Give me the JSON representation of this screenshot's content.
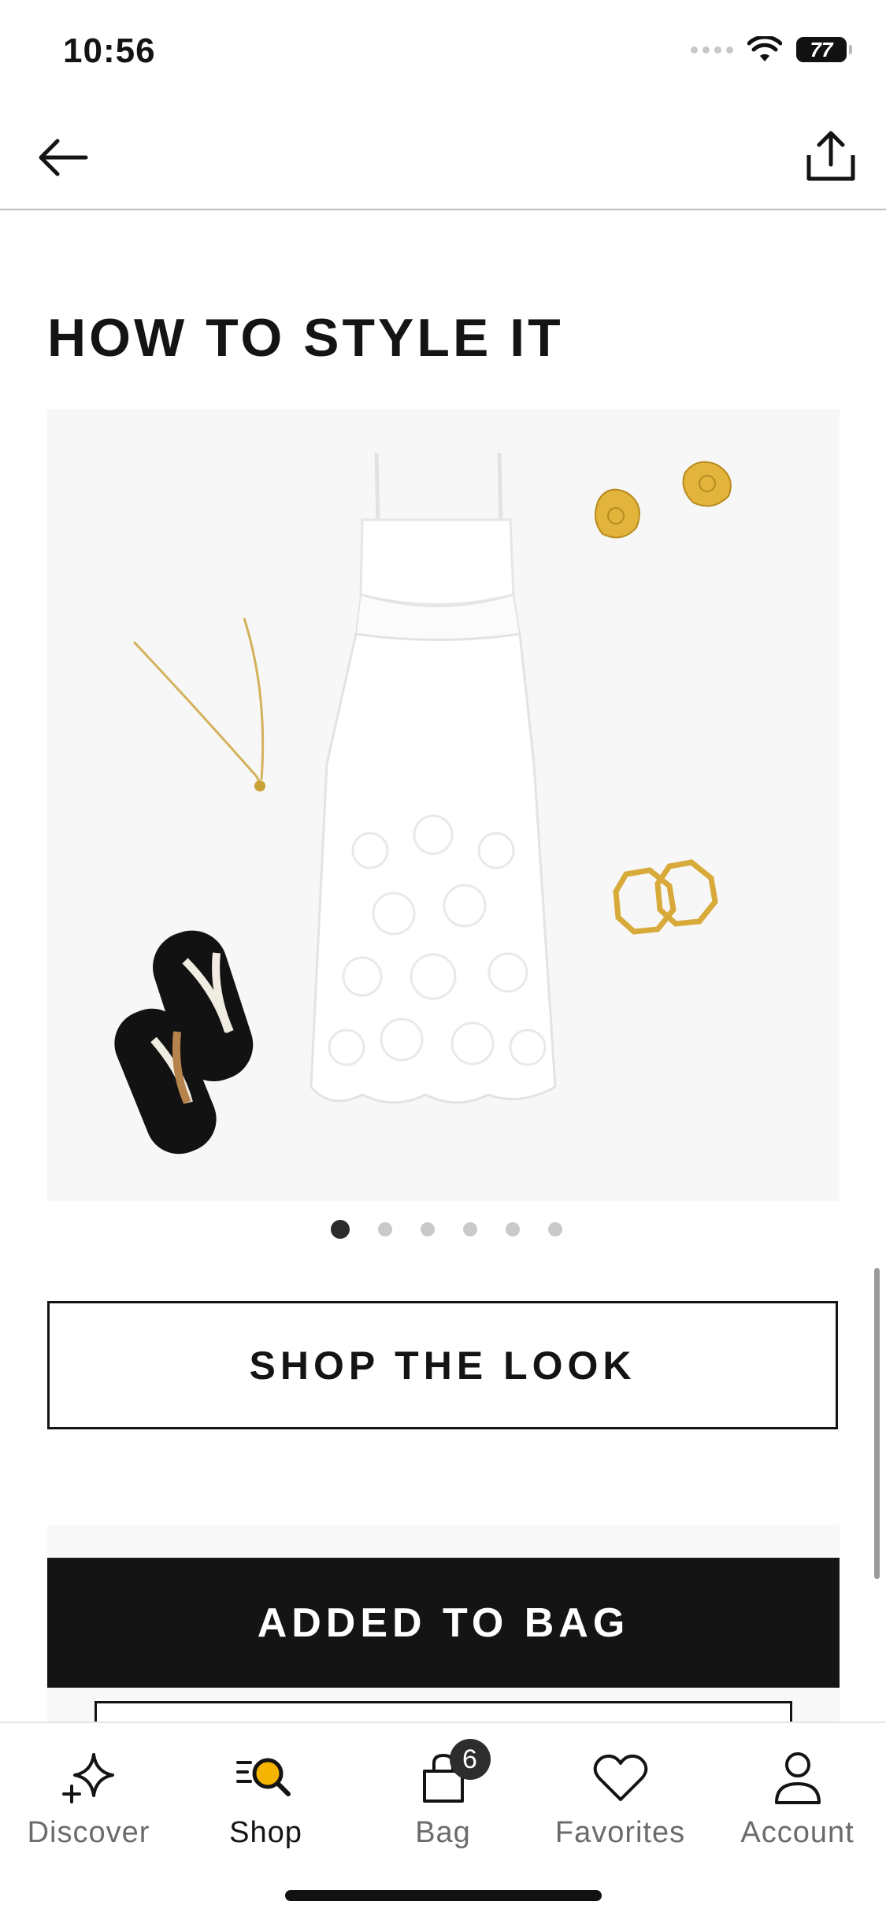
{
  "status_bar": {
    "time": "10:56",
    "battery": "77"
  },
  "section": {
    "title": "HOW TO STYLE IT"
  },
  "carousel": {
    "page_count": 6,
    "active_index": 0
  },
  "buttons": {
    "shop_the_look": "SHOP THE LOOK",
    "added_to_bag": "ADDED TO BAG"
  },
  "tab_bar": {
    "items": [
      {
        "label": "Discover",
        "icon": "sparkle-icon"
      },
      {
        "label": "Shop",
        "icon": "shop-search-icon"
      },
      {
        "label": "Bag",
        "icon": "bag-icon",
        "badge": "6"
      },
      {
        "label": "Favorites",
        "icon": "heart-icon"
      },
      {
        "label": "Account",
        "icon": "person-icon"
      }
    ],
    "active": "Shop"
  },
  "colors": {
    "primary": "#141414",
    "accent": "#f5b400",
    "image_bg": "#f7f7f7"
  }
}
